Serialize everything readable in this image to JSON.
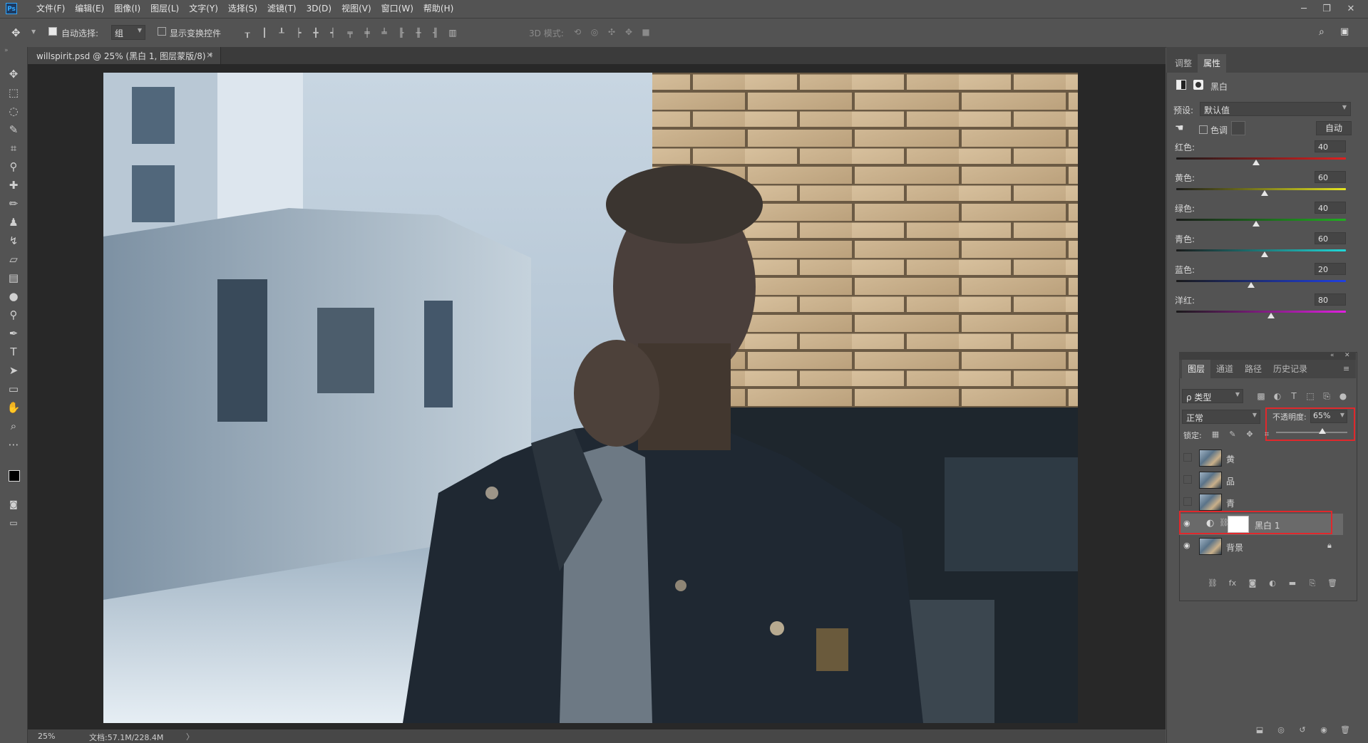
{
  "app": {
    "logo": "Ps"
  },
  "menu": [
    "文件(F)",
    "编辑(E)",
    "图像(I)",
    "图层(L)",
    "文字(Y)",
    "选择(S)",
    "滤镜(T)",
    "3D(D)",
    "视图(V)",
    "窗口(W)",
    "帮助(H)"
  ],
  "options_bar": {
    "auto_select_label": "自动选择:",
    "auto_select_checked": true,
    "auto_select_value": "组",
    "show_transform_label": "显示变换控件",
    "show_transform_checked": false,
    "mode_3d_label": "3D 模式:"
  },
  "document_tab": {
    "title": "willspirit.psd @ 25% (黑白 1, 图层蒙版/8) *",
    "close": "×"
  },
  "status": {
    "zoom": "25%",
    "doc": "文档:57.1M/228.4M",
    "arrow": "〉"
  },
  "properties_panel": {
    "tabs": [
      "调整",
      "属性"
    ],
    "active_tab": "属性",
    "adjustment_name": "黑白",
    "preset_label": "预设:",
    "preset_value": "默认值",
    "tint_label": "色调",
    "auto_button": "自动",
    "sliders": [
      {
        "label": "红色:",
        "value": "40",
        "gradient": [
          "#1a1a1a",
          "#e02020"
        ],
        "pos": 0.47
      },
      {
        "label": "黄色:",
        "value": "60",
        "gradient": [
          "#1a1a1a",
          "#e6e620"
        ],
        "pos": 0.52
      },
      {
        "label": "绿色:",
        "value": "40",
        "gradient": [
          "#1a1a1a",
          "#20b020"
        ],
        "pos": 0.47
      },
      {
        "label": "青色:",
        "value": "60",
        "gradient": [
          "#1a1a1a",
          "#20d8d8"
        ],
        "pos": 0.52
      },
      {
        "label": "蓝色:",
        "value": "20",
        "gradient": [
          "#1a1a1a",
          "#2040e0"
        ],
        "pos": 0.44
      },
      {
        "label": "洋红:",
        "value": "80",
        "gradient": [
          "#1a1a1a",
          "#e020e0"
        ],
        "pos": 0.56
      }
    ]
  },
  "layers_panel": {
    "tabs": [
      "图层",
      "通道",
      "路径",
      "历史记录"
    ],
    "active_tab": "图层",
    "filter_label": "ρ 类型",
    "blend_mode": "正常",
    "opacity_label": "不透明度:",
    "opacity_value": "65%",
    "opacity_fraction": 0.65,
    "lock_label": "锁定:",
    "layers": [
      {
        "name": "黄",
        "visible": false,
        "type": "image"
      },
      {
        "name": "品",
        "visible": false,
        "type": "image"
      },
      {
        "name": "青",
        "visible": false,
        "type": "image"
      },
      {
        "name": "黑白 1",
        "visible": true,
        "type": "adjustment",
        "selected": true
      },
      {
        "name": "背景",
        "visible": true,
        "type": "image",
        "locked": true
      }
    ]
  },
  "colors": {
    "accent_red": "#e0282c",
    "panel_bg": "#535353",
    "canvas_bg": "#282828"
  }
}
